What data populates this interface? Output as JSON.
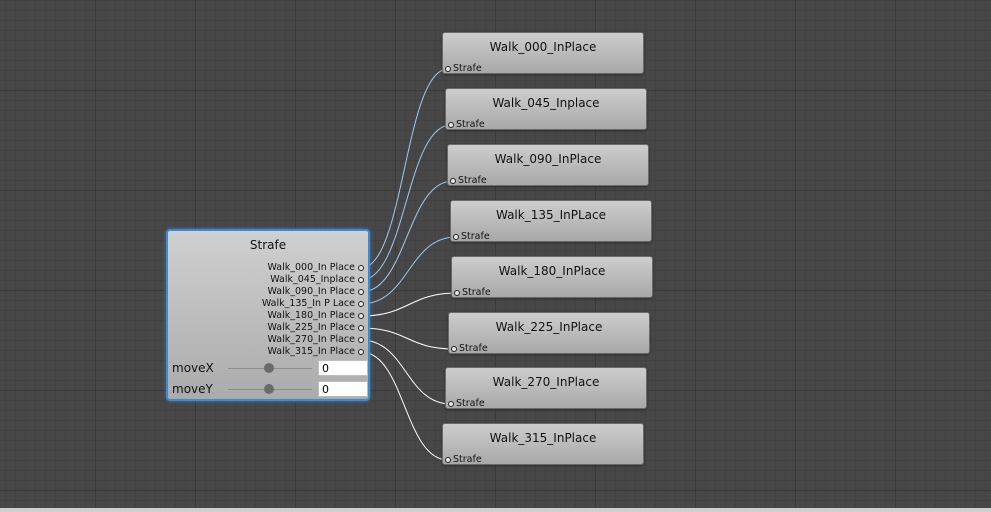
{
  "blend_tree": {
    "title": "Strafe",
    "outputs": [
      "Walk_000_In Place",
      "Walk_045_Inplace",
      "Walk_090_In Place",
      "Walk_135_In P Lace",
      "Walk_180_In Place",
      "Walk_225_In Place",
      "Walk_270_In Place",
      "Walk_315_In Place"
    ],
    "params": [
      {
        "label": "moveX",
        "value": "0"
      },
      {
        "label": "moveY",
        "value": "0"
      }
    ]
  },
  "motion_nodes": [
    {
      "title": "Walk_000_InPlace",
      "input_label": "Strafe"
    },
    {
      "title": "Walk_045_Inplace",
      "input_label": "Strafe"
    },
    {
      "title": "Walk_090_InPlace",
      "input_label": "Strafe"
    },
    {
      "title": "Walk_135_InPLace",
      "input_label": "Strafe"
    },
    {
      "title": "Walk_180_InPlace",
      "input_label": "Strafe"
    },
    {
      "title": "Walk_225_InPlace",
      "input_label": "Strafe"
    },
    {
      "title": "Walk_270_InPlace",
      "input_label": "Strafe"
    },
    {
      "title": "Walk_315_InPlace",
      "input_label": "Strafe"
    }
  ],
  "colors": {
    "selection_border": "#3d89d4",
    "wire_color": "#ffffff",
    "wire_highlight": "#9ec9f0"
  }
}
